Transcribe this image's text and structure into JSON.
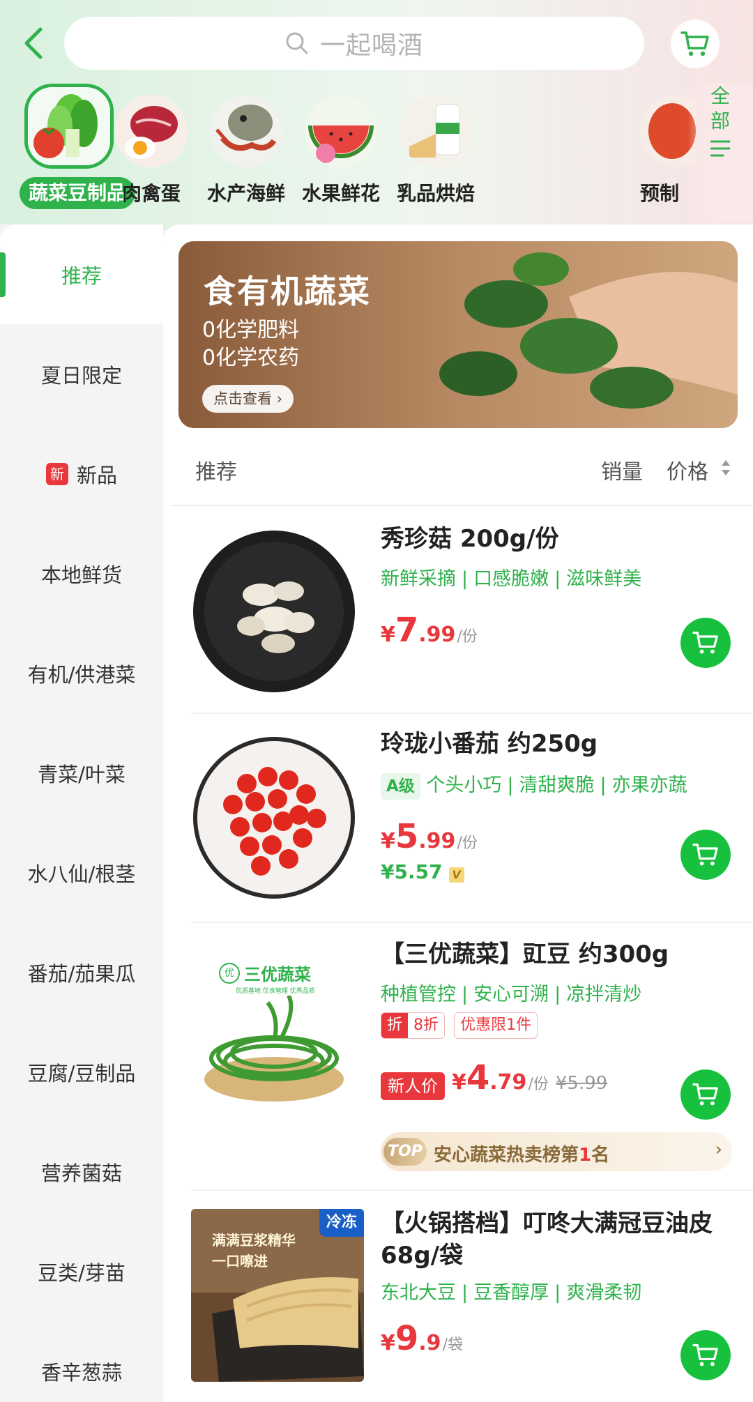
{
  "search": {
    "placeholder": "一起喝酒"
  },
  "categories": [
    {
      "label": "蔬菜豆制品",
      "active": true
    },
    {
      "label": "肉禽蛋"
    },
    {
      "label": "水产海鲜"
    },
    {
      "label": "水果鲜花"
    },
    {
      "label": "乳品烘焙"
    },
    {
      "label": "预制"
    }
  ],
  "all_button": {
    "line1": "全",
    "line2": "部"
  },
  "sidebar": [
    {
      "label": "推荐",
      "active": true
    },
    {
      "label": "夏日限定"
    },
    {
      "label": "新品",
      "badge": "新"
    },
    {
      "label": "本地鲜货"
    },
    {
      "label": "有机/供港菜"
    },
    {
      "label": "青菜/叶菜"
    },
    {
      "label": "水八仙/根茎"
    },
    {
      "label": "番茄/茄果瓜"
    },
    {
      "label": "豆腐/豆制品"
    },
    {
      "label": "营养菌菇"
    },
    {
      "label": "豆类/芽苗"
    },
    {
      "label": "香辛葱蒜"
    }
  ],
  "banner": {
    "title": "食有机蔬菜",
    "line1": "0化学肥料",
    "line2": "0化学农药",
    "button": "点击查看 ›"
  },
  "sort": {
    "recommend": "推荐",
    "sales": "销量",
    "price": "价格"
  },
  "products": [
    {
      "name": "秀珍菇 200g/份",
      "tags": [
        "新鲜采摘",
        "口感脆嫩",
        "滋味鲜美"
      ],
      "yen": "¥",
      "price_int": "7",
      "price_dec": ".99",
      "unit": "/份"
    },
    {
      "name": "玲珑小番茄 约250g",
      "grade": "A级",
      "tags": [
        "个头小巧",
        "清甜爽脆",
        "亦果亦蔬"
      ],
      "yen": "¥",
      "price_int": "5",
      "price_dec": ".99",
      "unit": "/份",
      "vip_price": "¥5.57",
      "vip_badge": "V"
    },
    {
      "name": "【三优蔬菜】豇豆 约300g",
      "image_brand": "三优蔬菜",
      "image_brand_logo": "优",
      "image_brand_sub": "优质基地 优良管理 优秀品质",
      "tags": [
        "种植管控",
        "安心可溯",
        "凉拌清炒"
      ],
      "discount_icon": "折",
      "discount": "8折",
      "limit": "优惠限1件",
      "new_price_label": "新人价",
      "yen": "¥",
      "price_int": "4",
      "price_dec": ".79",
      "unit": "/份",
      "old_price": "¥5.99",
      "rank_badge": "TOP",
      "rank_prefix": "安心蔬菜热卖榜第",
      "rank_num": "1",
      "rank_suffix": "名"
    },
    {
      "name": "【火锅搭档】叮咚大满冠豆油皮 68g/袋",
      "frozen": "冷冻",
      "image_text1": "满满豆浆精华",
      "image_text2": "一口嚓进",
      "tags": [
        "东北大豆",
        "豆香醇厚",
        "爽滑柔韧"
      ],
      "yen": "¥",
      "price_int": "9",
      "price_dec": ".9",
      "unit": "/袋"
    }
  ],
  "colors": {
    "brand_green": "#2fb24c",
    "price_red": "#e8383d",
    "cart_green": "#17c13d"
  }
}
